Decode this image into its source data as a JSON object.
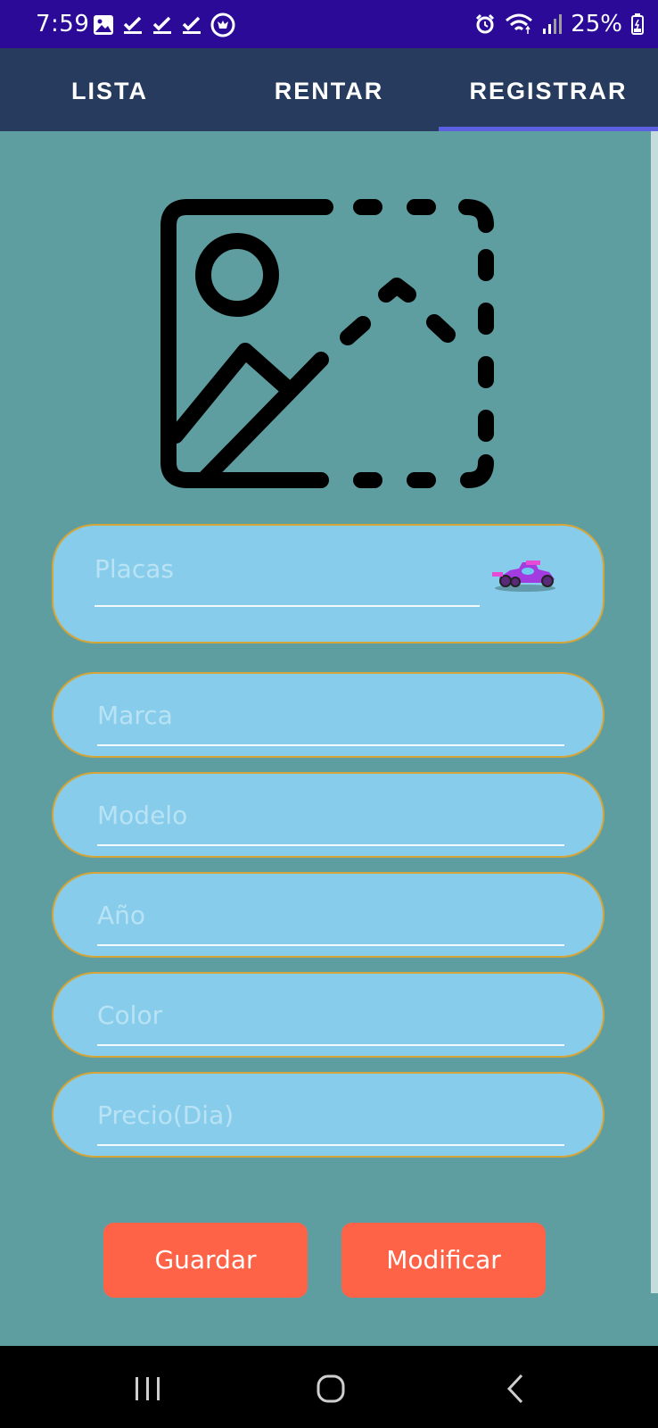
{
  "status_bar": {
    "time": "7:59",
    "battery": "25%",
    "left_icons": [
      "gallery-icon",
      "check-icon",
      "check-icon",
      "check-icon",
      "shield-icon"
    ],
    "right_icons": [
      "alarm-icon",
      "wifi-icon",
      "signal-icon",
      "battery-icon"
    ]
  },
  "tabs": [
    {
      "label": "LISTA"
    },
    {
      "label": "RENTAR"
    },
    {
      "label": "REGISTRAR",
      "selected": true
    }
  ],
  "form": {
    "image_placeholder_icon": "add-image-icon",
    "fields": [
      {
        "placeholder": "Placas"
      },
      {
        "placeholder": "Marca"
      },
      {
        "placeholder": "Modelo"
      },
      {
        "placeholder": "Año"
      },
      {
        "placeholder": "Color"
      },
      {
        "placeholder": "Precio(Dia)"
      }
    ]
  },
  "buttons": {
    "save_label": "Guardar",
    "modify_label": "Modificar"
  },
  "nav": {
    "icons": [
      "recents-icon",
      "home-icon",
      "back-icon"
    ]
  },
  "colors": {
    "status_bar": "#2A0A96",
    "tab_bar": "#263B5E",
    "background": "#5F9EA0",
    "field_fill": "#87CDEB",
    "field_border": "#D4A537",
    "button": "#FF6347",
    "tab_indicator": "#5B5FE0"
  }
}
